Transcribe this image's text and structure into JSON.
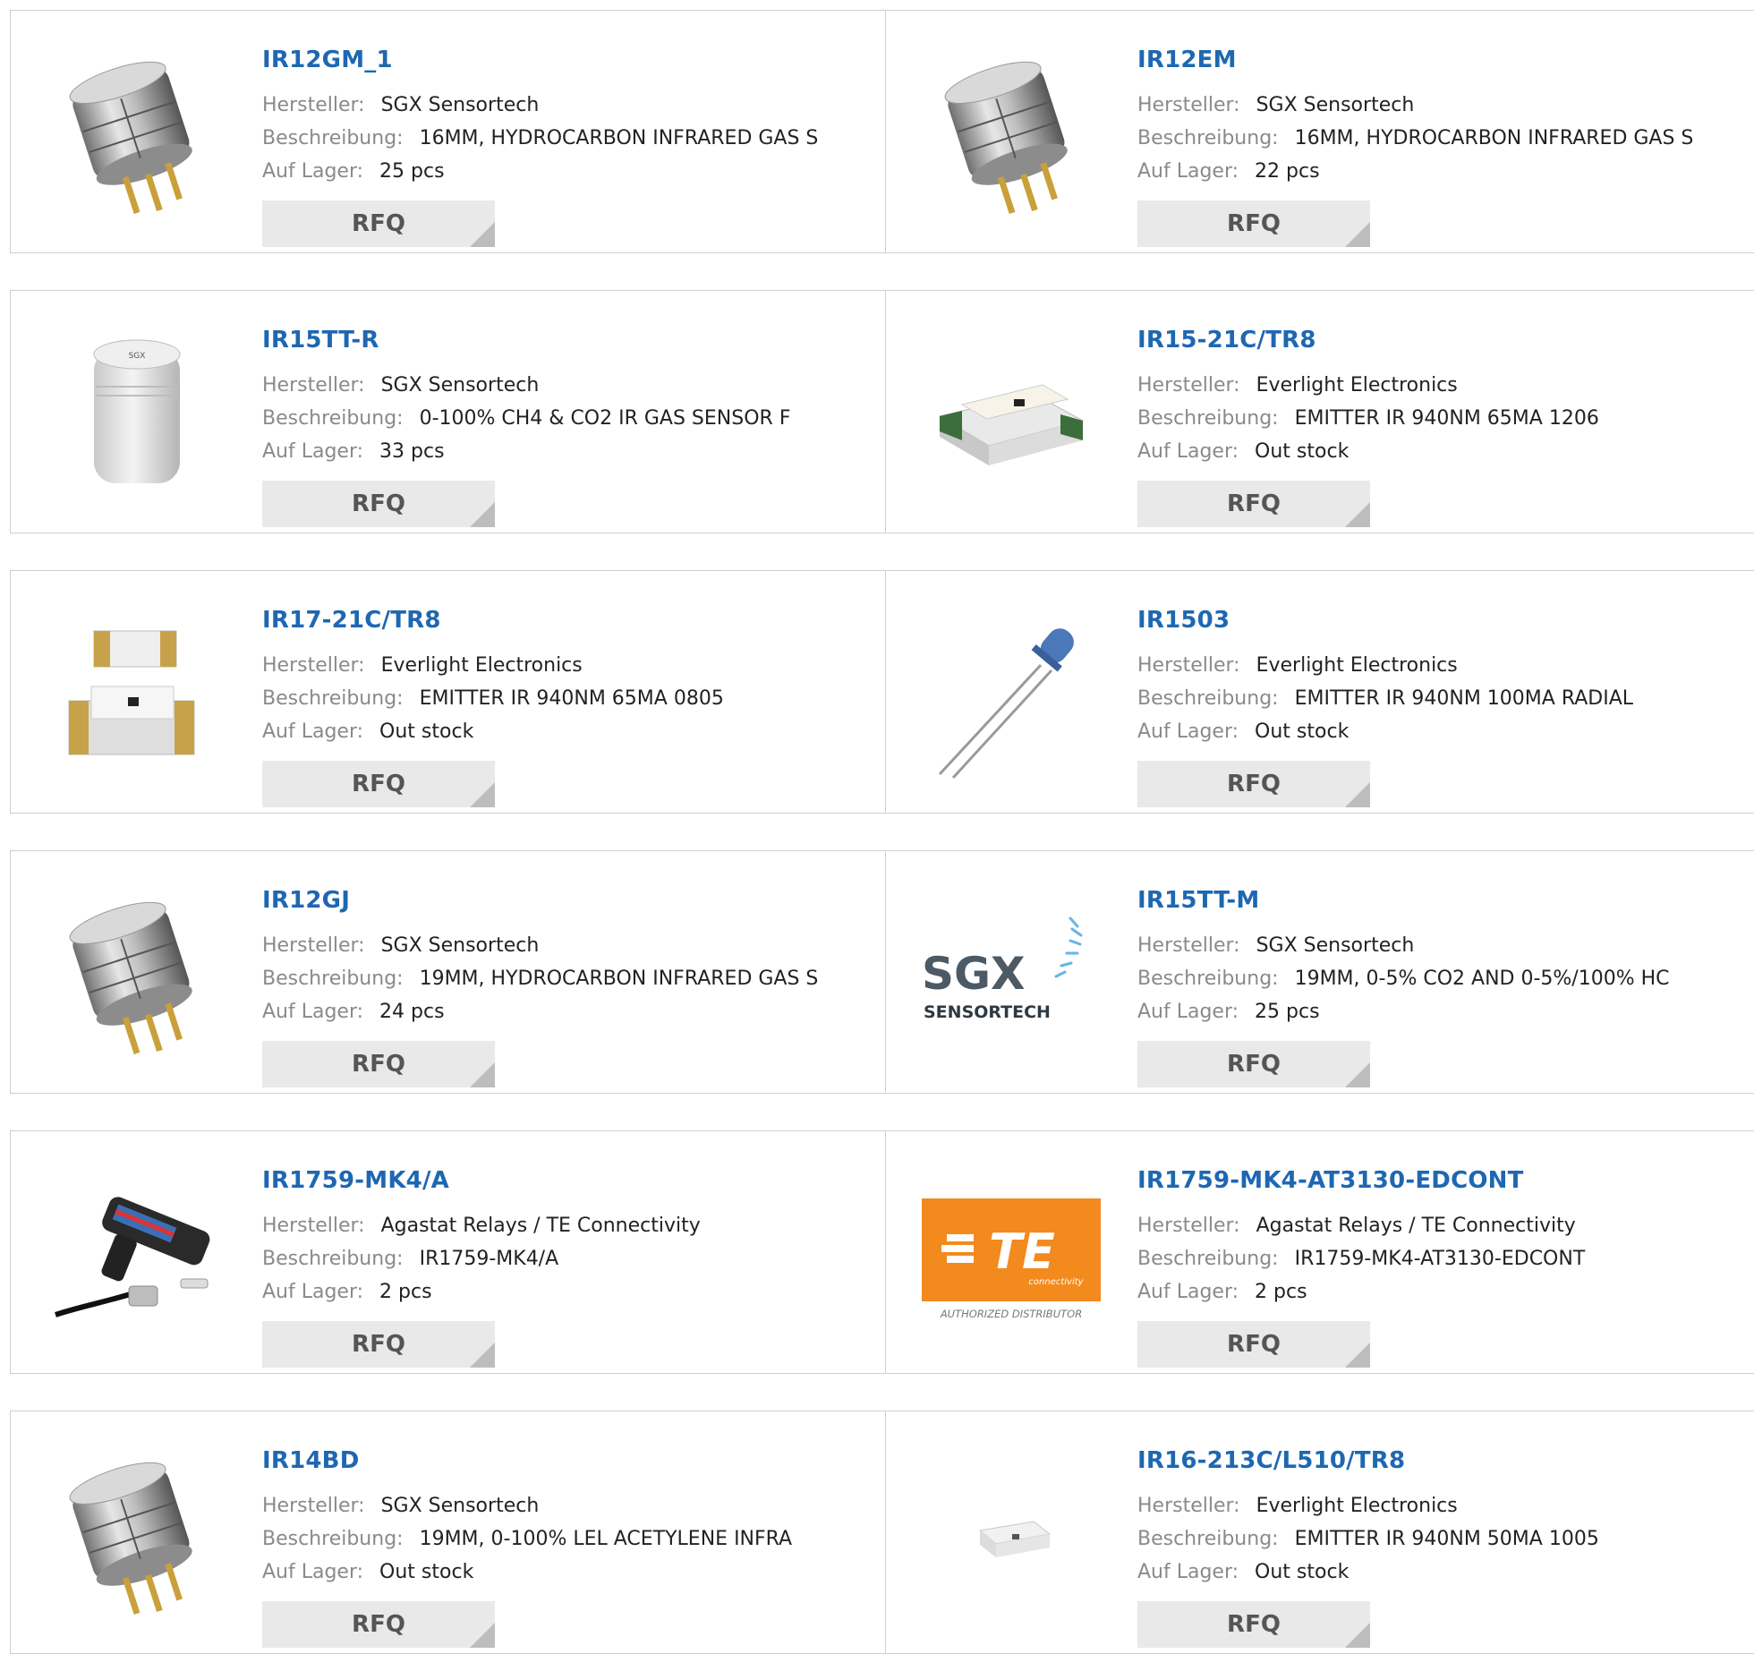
{
  "labels": {
    "manufacturer": "Hersteller:",
    "description": "Beschreibung:",
    "stock": "Auf Lager:",
    "rfq": "RFQ"
  },
  "colors": {
    "product_link": "#1e67b2",
    "label": "#8a8a8a",
    "value": "#222222",
    "rfq_bg": "#e9e9e9",
    "border": "#cfcfcf"
  },
  "products": [
    {
      "name": "IR12GM_1",
      "manufacturer": "SGX Sensortech",
      "description": "16MM, HYDROCARBON INFRARED GAS S",
      "stock": "25 pcs",
      "image": "gas-sensor-image"
    },
    {
      "name": "IR12EM",
      "manufacturer": "SGX Sensortech",
      "description": "16MM, HYDROCARBON INFRARED GAS S",
      "stock": "22 pcs",
      "image": "gas-sensor-image"
    },
    {
      "name": "IR15TT-R",
      "manufacturer": "SGX Sensortech",
      "description": "0-100% CH4 & CO2 IR GAS SENSOR F",
      "stock": "33 pcs",
      "image": "white-sensor-image"
    },
    {
      "name": "IR15-21C/TR8",
      "manufacturer": "Everlight Electronics",
      "description": "EMITTER IR 940NM 65MA 1206",
      "stock": "Out stock",
      "image": "smd-led-image"
    },
    {
      "name": "IR17-21C/TR8",
      "manufacturer": "Everlight Electronics",
      "description": "EMITTER IR 940NM 65MA 0805",
      "stock": "Out stock",
      "image": "smd-led-pair-image"
    },
    {
      "name": "IR1503",
      "manufacturer": "Everlight Electronics",
      "description": "EMITTER IR 940NM 100MA RADIAL",
      "stock": "Out stock",
      "image": "radial-led-image"
    },
    {
      "name": "IR12GJ",
      "manufacturer": "SGX Sensortech",
      "description": "19MM, HYDROCARBON INFRARED GAS S",
      "stock": "24 pcs",
      "image": "gas-sensor-image"
    },
    {
      "name": "IR15TT-M",
      "manufacturer": "SGX Sensortech",
      "description": "19MM, 0-5% CO2 AND 0-5%/100% HC",
      "stock": "25 pcs",
      "image": "sgx-logo-image",
      "logo_text": [
        "SGX",
        "SENSORTECH"
      ]
    },
    {
      "name": "IR1759-MK4/A",
      "manufacturer": "Agastat Relays / TE Connectivity",
      "description": "IR1759-MK4/A",
      "stock": "2 pcs",
      "image": "ir-gun-image"
    },
    {
      "name": "IR1759-MK4-AT3130-EDCONT",
      "manufacturer": "Agastat Relays / TE Connectivity",
      "description": "IR1759-MK4-AT3130-EDCONT",
      "stock": "2 pcs",
      "image": "te-logo-image",
      "logo_text": [
        "TE",
        "connectivity",
        "AUTHORIZED DISTRIBUTOR"
      ]
    },
    {
      "name": "IR14BD",
      "manufacturer": "SGX Sensortech",
      "description": "19MM, 0-100% LEL ACETYLENE INFRA",
      "stock": "Out stock",
      "image": "gas-sensor-image"
    },
    {
      "name": "IR16-213C/L510/TR8",
      "manufacturer": "Everlight Electronics",
      "description": "EMITTER IR 940NM 50MA 1005",
      "stock": "Out stock",
      "image": "tiny-led-image"
    }
  ]
}
